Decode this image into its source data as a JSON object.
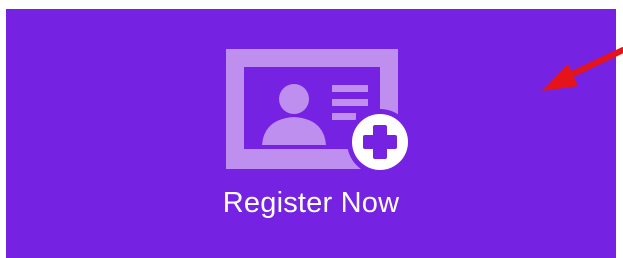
{
  "register_tile": {
    "label": "Register Now",
    "background": "#7622e2"
  },
  "icons": {
    "card": "id-card-icon",
    "add": "plus-circle-icon",
    "annotation": "red-arrow-icon"
  },
  "colors": {
    "icon_light": "#bf8ff0",
    "icon_white": "#ffffff",
    "arrow": "#e5141b"
  }
}
